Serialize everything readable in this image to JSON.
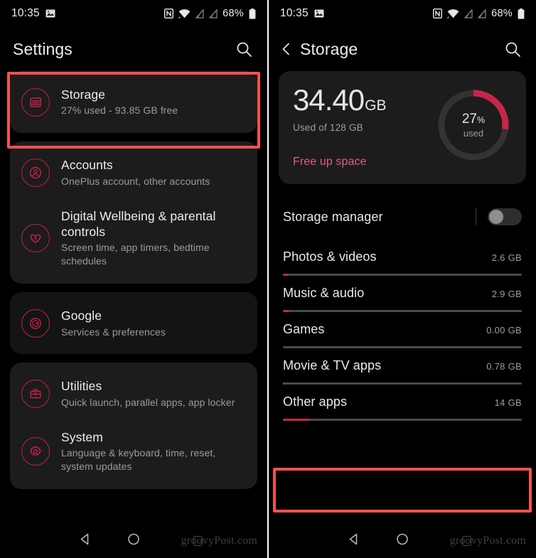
{
  "statusbar": {
    "time": "10:35",
    "battery_text": "68%",
    "icons": [
      "photo-icon",
      "nfc-icon",
      "wifi-icon",
      "signal-off-icon",
      "signal-off-icon-2",
      "battery-icon"
    ]
  },
  "left_screen": {
    "title": "Settings",
    "search_icon": "search-icon",
    "cards": [
      {
        "highlighted": true,
        "rows": [
          {
            "icon": "storage-icon",
            "title": "Storage",
            "subtitle": "27% used - 93.85 GB free"
          }
        ]
      },
      {
        "highlighted": false,
        "rows": [
          {
            "icon": "account-icon",
            "title": "Accounts",
            "subtitle": "OnePlus account, other accounts"
          },
          {
            "icon": "heart-wellbeing-icon",
            "title": "Digital Wellbeing & parental controls",
            "subtitle": "Screen time, app timers, bedtime schedules"
          }
        ]
      },
      {
        "highlighted": false,
        "plain": true,
        "rows": [
          {
            "icon": "google-icon",
            "title": "Google",
            "subtitle": "Services & preferences"
          }
        ]
      },
      {
        "highlighted": false,
        "rows": [
          {
            "icon": "toolbox-icon",
            "title": "Utilities",
            "subtitle": "Quick launch, parallel apps, app locker"
          },
          {
            "icon": "gear-icon",
            "title": "System",
            "subtitle": "Language & keyboard, time, reset, system updates"
          }
        ]
      }
    ]
  },
  "right_screen": {
    "title": "Storage",
    "back_icon": "chevron-left-icon",
    "search_icon": "search-icon",
    "summary": {
      "used_value": "34.40",
      "used_unit": "GB",
      "capacity_text": "Used of 128 GB",
      "free_up_label": "Free up space",
      "ring_percent_value": "27",
      "ring_percent_symbol": "%",
      "ring_caption": "used",
      "ring_percent_number": 27
    },
    "storage_manager": {
      "label": "Storage manager",
      "enabled": false
    },
    "categories": [
      {
        "name": "Photos & videos",
        "size": "2.6 GB",
        "fill_percent": 2.5
      },
      {
        "name": "Music & audio",
        "size": "2.9 GB",
        "fill_percent": 2.8
      },
      {
        "name": "Games",
        "size": "0.00 GB",
        "fill_percent": 0
      },
      {
        "name": "Movie & TV apps",
        "size": "0.78 GB",
        "fill_percent": 0.8
      },
      {
        "name": "Other apps",
        "size": "14 GB",
        "fill_percent": 11,
        "highlighted": true
      }
    ]
  },
  "navbar": {
    "back_icon": "triangle-back-icon",
    "home_icon": "circle-home-icon",
    "watermark": "groovyPost.com"
  },
  "colors": {
    "accent_red": "#c7264b",
    "highlight_red": "#f9514e",
    "card_bg": "#1c1c1c",
    "screen_bg": "#000000",
    "pink_link": "#e0607f"
  }
}
